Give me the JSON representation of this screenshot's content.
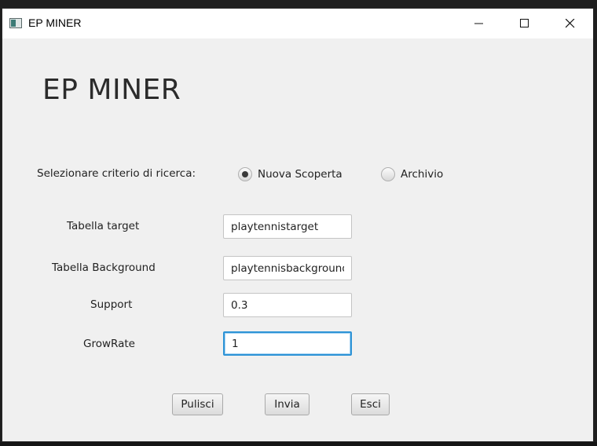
{
  "window": {
    "title": "EP MINER"
  },
  "heading": "EP MINER",
  "criteria": {
    "label": "Selezionare criterio di ricerca:",
    "options": [
      {
        "label": "Nuova Scoperta",
        "selected": true
      },
      {
        "label": "Archivio",
        "selected": false
      }
    ]
  },
  "fields": {
    "target": {
      "label": "Tabella target",
      "value": "playtennistarget"
    },
    "background": {
      "label": "Tabella Background",
      "value": "playtennisbackground"
    },
    "support": {
      "label": "Support",
      "value": "0.3"
    },
    "growrate": {
      "label": "GrowRate",
      "value": "1"
    }
  },
  "buttons": {
    "pulisci": "Pulisci",
    "invia": "Invia",
    "esci": "Esci"
  },
  "icons": {
    "app": "app-window-icon",
    "minimize": "minimize-icon",
    "maximize": "maximize-icon",
    "close": "close-icon"
  },
  "colors": {
    "window_bg": "#f0f0f0",
    "focus_border": "#2d93d6"
  }
}
